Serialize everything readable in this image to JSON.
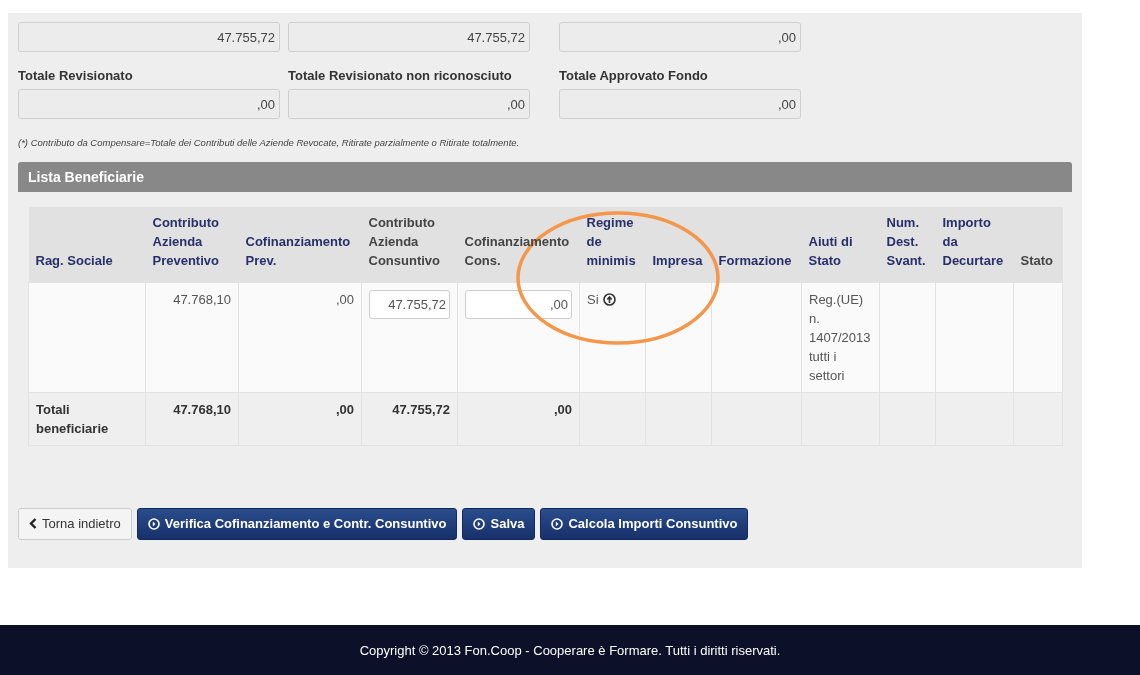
{
  "top_fields": [
    {
      "value": "47.755,72"
    },
    {
      "value": "47.755,72"
    },
    {
      "value": ",00"
    }
  ],
  "totals_fields": [
    {
      "label": "Totale Revisionato",
      "value": ",00"
    },
    {
      "label": "Totale Revisionato non riconosciuto",
      "value": ",00"
    },
    {
      "label": "Totale Approvato Fondo",
      "value": ",00"
    }
  ],
  "note": "(*) Contributo da Compensare=Totale dei Contributi delle Aziende Revocate, Ritirate parzialmente o Ritirate totalmente.",
  "section_title": "Lista Beneficiarie",
  "table": {
    "columns": [
      {
        "label": "Rag. Sociale",
        "link": true
      },
      {
        "label": "Contributo Azienda Preventivo",
        "link": true
      },
      {
        "label": "Cofinanziamento Prev.",
        "link": true
      },
      {
        "label": "Contributo Azienda Consuntivo",
        "link": false
      },
      {
        "label": "Cofinanziamento Cons.",
        "link": false
      },
      {
        "label": "Regime de minimis",
        "link": true
      },
      {
        "label": "Impresa",
        "link": true
      },
      {
        "label": "Formazione",
        "link": true
      },
      {
        "label": "Aiuti di Stato",
        "link": true
      },
      {
        "label": "Num. Dest. Svant.",
        "link": true
      },
      {
        "label": "Importo da Decurtare",
        "link": true
      },
      {
        "label": "Stato",
        "link": false
      }
    ],
    "rows": [
      {
        "kind": "data",
        "cells": [
          null,
          {
            "kind": "number",
            "text": "47.768,10"
          },
          {
            "kind": "number",
            "text": ",00"
          },
          {
            "kind": "input",
            "text": "47.755,72"
          },
          {
            "kind": "input",
            "text": ",00"
          },
          {
            "kind": "info",
            "text": "Si"
          },
          null,
          null,
          {
            "kind": "text",
            "text": "Reg.(UE) n. 1407/2013 tutti i settori"
          },
          null,
          null,
          null
        ]
      },
      {
        "kind": "total",
        "cells": [
          {
            "kind": "text",
            "text": "Totali beneficiarie"
          },
          {
            "kind": "number",
            "text": "47.768,10"
          },
          {
            "kind": "number",
            "text": ",00"
          },
          {
            "kind": "number",
            "text": "47.755,72"
          },
          {
            "kind": "number",
            "text": ",00"
          },
          null,
          null,
          null,
          null,
          null,
          null,
          null
        ]
      }
    ]
  },
  "buttons": [
    {
      "label": "Torna indietro",
      "kind": "back"
    },
    {
      "label": "Verifica Cofinanziamento e Contr. Consuntivo",
      "kind": "primary"
    },
    {
      "label": "Salva",
      "kind": "primary"
    },
    {
      "label": "Calcola Importi Consuntivo",
      "kind": "primary"
    }
  ],
  "footer": "Copyright © 2013 Fon.Coop - Cooperare è Formare. Tutti i diritti riservati."
}
